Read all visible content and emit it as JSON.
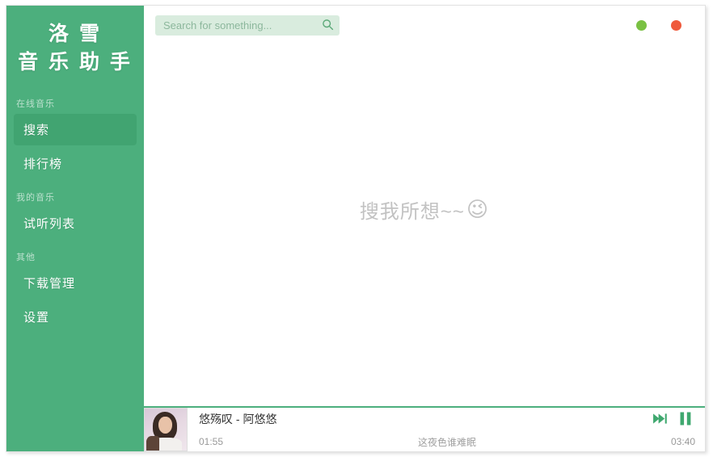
{
  "app": {
    "logo_line1": "洛 雪",
    "logo_line2": "音 乐 助 手"
  },
  "sidebar": {
    "groups": [
      {
        "label": "在线音乐",
        "items": [
          {
            "label": "搜索",
            "active": true
          },
          {
            "label": "排行榜",
            "active": false
          }
        ]
      },
      {
        "label": "我的音乐",
        "items": [
          {
            "label": "试听列表",
            "active": false
          }
        ]
      },
      {
        "label": "其他",
        "items": [
          {
            "label": "下载管理",
            "active": false
          },
          {
            "label": "设置",
            "active": false
          }
        ]
      }
    ]
  },
  "header": {
    "search_placeholder": "Search for something...",
    "search_value": "",
    "search_icon": "search-icon",
    "window_controls": {
      "minimize_icon": "minimize-dot",
      "minimize_color": "#7ac143",
      "close_icon": "close-dot",
      "close_color": "#ef5a3c"
    }
  },
  "content": {
    "empty_hint_text": "搜我所想~~",
    "empty_hint_emoji": "😉"
  },
  "player": {
    "song_title": "悠殇叹 - 阿悠悠",
    "current_time": "01:55",
    "total_time": "03:40",
    "lyric_line": "这夜色谁难眠",
    "progress_percent": 45,
    "next_icon": "next-track-icon",
    "pause_icon": "pause-icon",
    "accent_color": "#4caf7d",
    "album_art_alt": "album-art"
  }
}
